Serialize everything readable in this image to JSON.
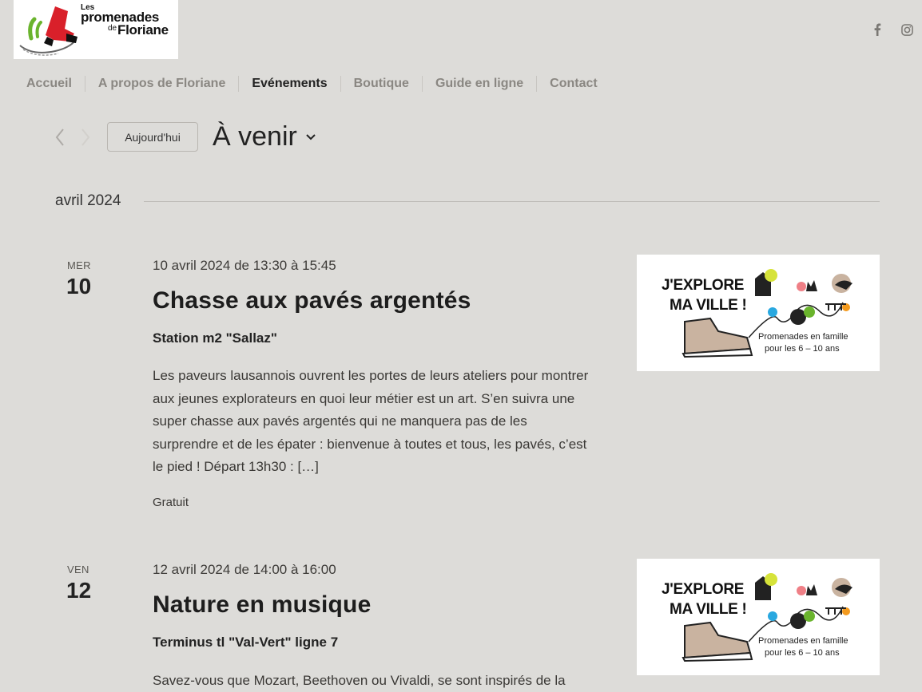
{
  "brand": {
    "line1": "Les",
    "line2": "promenades",
    "line3": "de",
    "line4": "Floriane"
  },
  "social": {
    "facebook_icon": "facebook-icon",
    "instagram_icon": "instagram-icon"
  },
  "nav": {
    "items": [
      {
        "label": "Accueil"
      },
      {
        "label": "A propos de Floriane"
      },
      {
        "label": "Evénements"
      },
      {
        "label": "Boutique"
      },
      {
        "label": "Guide en ligne"
      },
      {
        "label": "Contact"
      }
    ],
    "active": "Evénements"
  },
  "toolbar": {
    "today_label": "Aujourd'hui",
    "view_label": "À venir"
  },
  "month": {
    "label": "avril 2024"
  },
  "events": [
    {
      "dow": "MER",
      "day": "10",
      "datetime": "10 avril 2024 de 13:30 à 15:45",
      "title": "Chasse aux pavés argentés",
      "venue": "Station m2 \"Sallaz\"",
      "desc": "Les paveurs lausannois ouvrent les portes de leurs ateliers pour montrer aux jeunes explorateurs en quoi leur métier est un art. S’en suivra une super chasse aux pavés argentés qui ne manquera pas de les surprendre et de les épater : bienvenue à toutes et tous, les pavés, c’est le pied ! Départ 13h30 : […]",
      "cost": "Gratuit",
      "image": {
        "line1": "J'EXPLORE",
        "line2": "MA VILLE !",
        "cap1": "Promenades en famille",
        "cap2": "pour les 6 – 10 ans"
      }
    },
    {
      "dow": "VEN",
      "day": "12",
      "datetime": "12 avril 2024 de 14:00 à 16:00",
      "title": "Nature en musique",
      "venue": "Terminus tl \"Val-Vert\" ligne 7",
      "desc": "Savez-vous que Mozart, Beethoven ou Vivaldi, se sont inspirés de la",
      "image": {
        "line1": "J'EXPLORE",
        "line2": "MA VILLE !",
        "cap1": "Promenades en famille",
        "cap2": "pour les 6 – 10 ans"
      }
    }
  ],
  "colors": {
    "background": "#dddcd9",
    "nav_inactive": "#8a8782",
    "nav_active": "#222222",
    "accent_red": "#d9202a",
    "accent_green": "#6ab42d"
  }
}
